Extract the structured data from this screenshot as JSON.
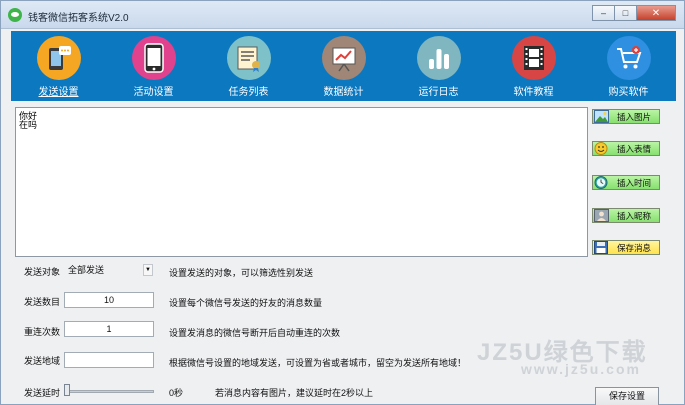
{
  "window": {
    "title": "钱客微信拓客系统V2.0",
    "controls": {
      "minimize": "–",
      "maximize": "□",
      "close": "✕"
    }
  },
  "colors": {
    "toolbar_bg": "#0b78c0",
    "tool_send": "#f5a623",
    "tool_activity": "#e0428d",
    "tool_task": "#7fc1c8",
    "tool_stats": "#a08676",
    "tool_log": "#7fb6c0",
    "tool_tutorial": "#d74545",
    "tool_buy": "#2f8fe0"
  },
  "toolbar": [
    {
      "label": "发送设置",
      "icon": "phone-chat-icon"
    },
    {
      "label": "活动设置",
      "icon": "smartphone-icon"
    },
    {
      "label": "任务列表",
      "icon": "certificate-list-icon"
    },
    {
      "label": "数据统计",
      "icon": "chart-board-icon"
    },
    {
      "label": "运行日志",
      "icon": "bar-chart-icon"
    },
    {
      "label": "软件教程",
      "icon": "film-icon"
    },
    {
      "label": "购买软件",
      "icon": "cart-icon"
    }
  ],
  "message": {
    "lines": [
      "你好",
      "在吗"
    ]
  },
  "side_buttons": {
    "insert_image": "插入图片",
    "insert_emoji": "插入表情",
    "insert_time": "插入时间",
    "insert_nickname": "插入昵称",
    "save_message": "保存消息"
  },
  "settings": {
    "target": {
      "label": "发送对象",
      "value": "全部发送",
      "desc": "设置发送的对象，可以筛选性别发送"
    },
    "count": {
      "label": "发送数目",
      "value": "10",
      "desc": "设置每个微信号发送的好友的消息数量"
    },
    "reconnect": {
      "label": "重连次数",
      "value": "1",
      "desc": "设置发消息的微信号断开后自动重连的次数"
    },
    "region": {
      "label": "发送地域",
      "value": "",
      "desc": "根据微信号设置的地域发送，可设置为省或者城市，留空为发送所有地域！"
    },
    "delay": {
      "label": "发送延时",
      "value_text": "0秒",
      "level": 0,
      "desc": "若消息内容有图片，建议延时在2秒以上"
    }
  },
  "save_settings": "保存设置",
  "watermark": {
    "main": "JZ5U绿色下载",
    "sub": "www.jz5u.com"
  }
}
